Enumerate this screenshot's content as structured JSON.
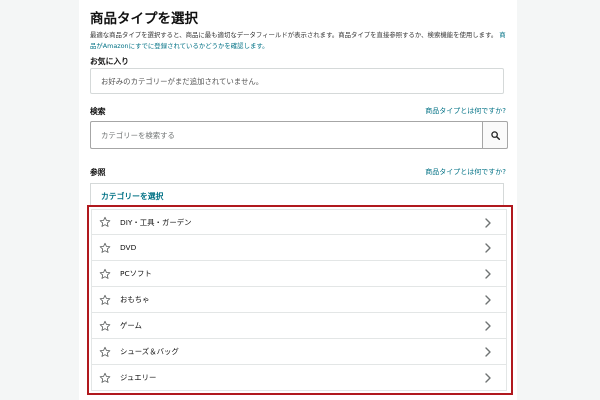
{
  "page": {
    "title": "商品タイプを選択",
    "description": "最適な商品タイプを選択すると、商品に最も適切なデータフィールドが表示されます。商品タイプを直接参照するか、検索機能を使用します。",
    "description_link": "商品がAmazonにすでに登録されているかどうかを確認します。"
  },
  "favorites": {
    "label": "お気に入り",
    "empty_text": "お好みのカテゴリーがまだ追加されていません。"
  },
  "search": {
    "label": "検索",
    "help_link": "商品タイプとは何ですか?",
    "placeholder": "カテゴリーを検索する"
  },
  "browse": {
    "label": "参照",
    "help_link": "商品タイプとは何ですか?",
    "header": "カテゴリーを選択",
    "categories": [
      {
        "name": "DIY・工具・ガーデン"
      },
      {
        "name": "DVD"
      },
      {
        "name": "PCソフト"
      },
      {
        "name": "おもちゃ"
      },
      {
        "name": "ゲーム"
      },
      {
        "name": "シューズ＆バッグ"
      },
      {
        "name": "ジュエリー"
      }
    ]
  },
  "colors": {
    "link": "#007185",
    "highlight_border": "#b0191e",
    "icon": "#565959"
  },
  "icons": {
    "search": "magnifier-icon",
    "star": "star-outline-icon",
    "chevron": "chevron-right-icon"
  }
}
